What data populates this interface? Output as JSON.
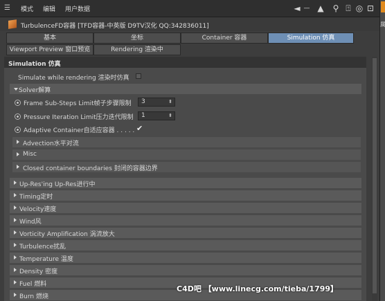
{
  "menu": {
    "items": [
      "模式",
      "编辑",
      "用户数据"
    ],
    "icons": [
      "back-arrow-icon",
      "up-arrow-icon",
      "search-icon",
      "lock-icon",
      "target-icon",
      "new-panel-icon"
    ]
  },
  "object": {
    "title": "TurbulenceFD容器 [TFD容器-中英版 D9TV汉化 QQ:342836011]"
  },
  "tabs_row1": [
    {
      "label": "基本",
      "active": false
    },
    {
      "label": "坐标",
      "active": false
    },
    {
      "label": "Container 容器",
      "active": false
    },
    {
      "label": "Simulation 仿真",
      "active": true
    }
  ],
  "tabs_row2": [
    {
      "label": "Viewport Preview 窗口预览"
    },
    {
      "label": "Rendering 渲染中"
    }
  ],
  "panel": {
    "heading": "Simulation 仿真",
    "simulate_label": "Simulate while rendering 渲染时仿真",
    "solver_label": "Solver解算",
    "frame_substeps_label": "Frame Sub-Steps Limit帧子步骤限制",
    "frame_substeps_value": "3",
    "pressure_label": "Pressure Iteration Limit压力迭代限制",
    "pressure_value": "1",
    "adaptive_label": "Adaptive Container自适应容器 . . . . .",
    "adaptive_check": "✔",
    "sub_sections": [
      "Advection水平对流",
      "Misc",
      "Closed container boundaries 封闭的容器边界"
    ],
    "sections": [
      "Up-Res'ing Up-Res进行中",
      "Timing定时",
      "Velocity速度",
      "Wind风",
      "Vorticity Amplification 涡流放大",
      "Turbulence扰乱",
      "Temperature 温度",
      "Density 密度",
      "Fuel 燃料",
      "Burn 燃烧"
    ]
  },
  "watermark": "C4D吧 【www.linecg.com/tieba/1799】",
  "right_strip_label": "属"
}
